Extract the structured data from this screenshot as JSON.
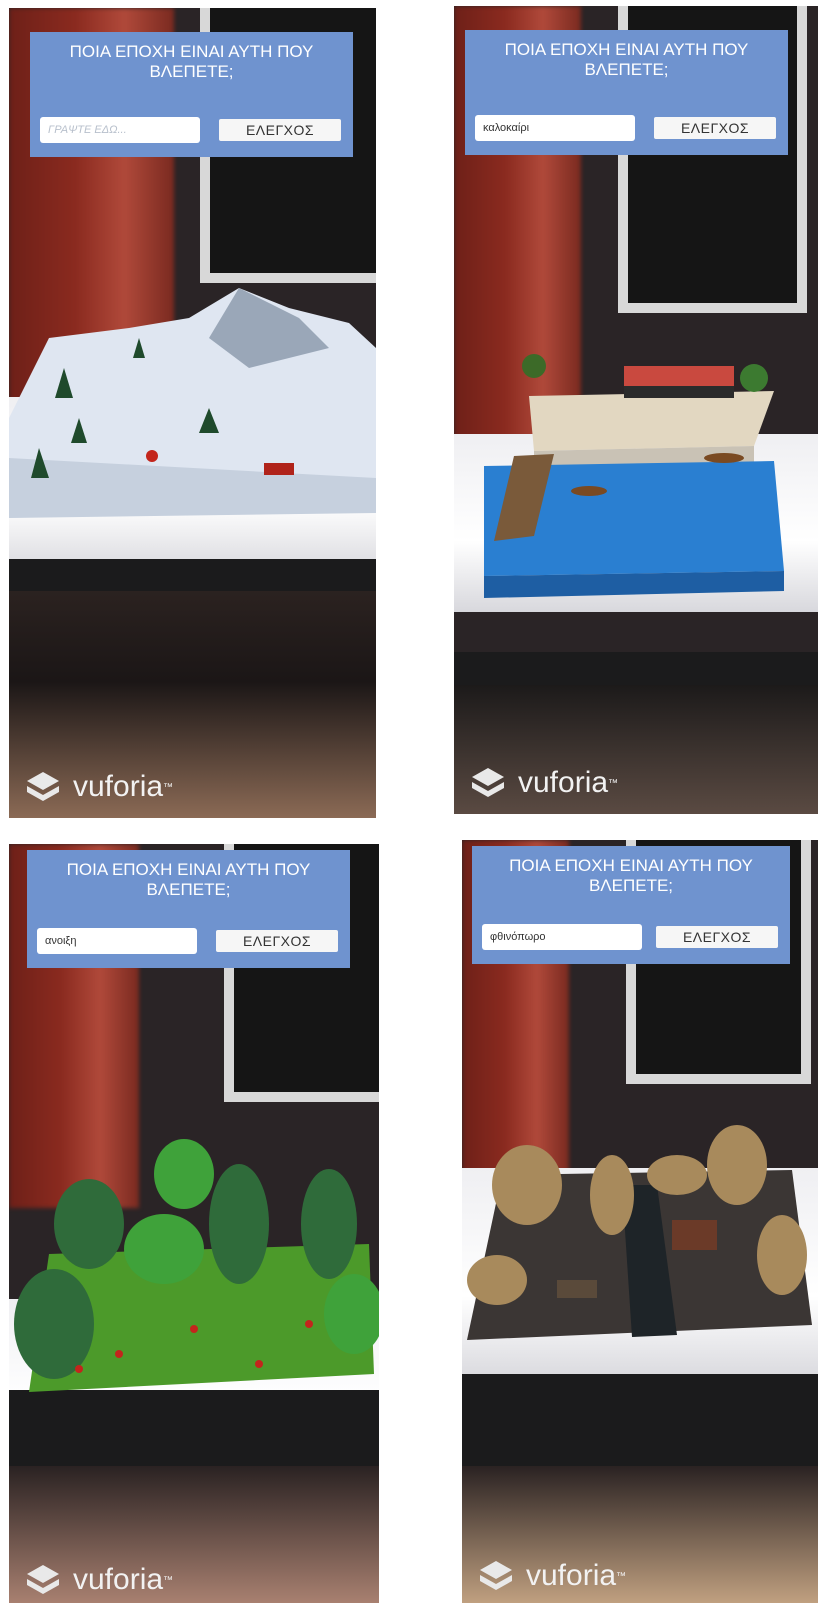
{
  "screens": [
    {
      "question": "ΠΟΙΑ ΕΠΟΧΗ ΕΙΝΑΙ ΑΥΤΗ ΠΟΥ ΒΛΕΠΕΤΕ;",
      "input_value": "",
      "input_placeholder": "ΓΡΑΨΤΕ ΕΔΩ...",
      "button": "ΕΛΕΓΧΟΣ",
      "brand": "vuforia",
      "scene": "winter-scene"
    },
    {
      "question": "ΠΟΙΑ ΕΠΟΧΗ ΕΙΝΑΙ ΑΥΤΗ ΠΟΥ ΒΛΕΠΕΤΕ;",
      "input_value": "καλοκαίρι",
      "input_placeholder": "",
      "button": "ΕΛΕΓΧΟΣ",
      "brand": "vuforia",
      "scene": "summer-scene"
    },
    {
      "question": "ΠΟΙΑ ΕΠΟΧΗ ΕΙΝΑΙ ΑΥΤΗ ΠΟΥ ΒΛΕΠΕΤΕ;",
      "input_value": "ανοιξη",
      "input_placeholder": "",
      "button": "ΕΛΕΓΧΟΣ",
      "brand": "vuforia",
      "scene": "spring-scene"
    },
    {
      "question": "ΠΟΙΑ ΕΠΟΧΗ ΕΙΝΑΙ ΑΥΤΗ ΠΟΥ ΒΛΕΠΕΤΕ;",
      "input_value": "φθινόπωρο",
      "input_placeholder": "",
      "button": "ΕΛΕΓΧΟΣ",
      "brand": "vuforia",
      "scene": "autumn-scene"
    }
  ],
  "colors": {
    "panel": "#6f93cf",
    "button": "#f6f6f6"
  }
}
